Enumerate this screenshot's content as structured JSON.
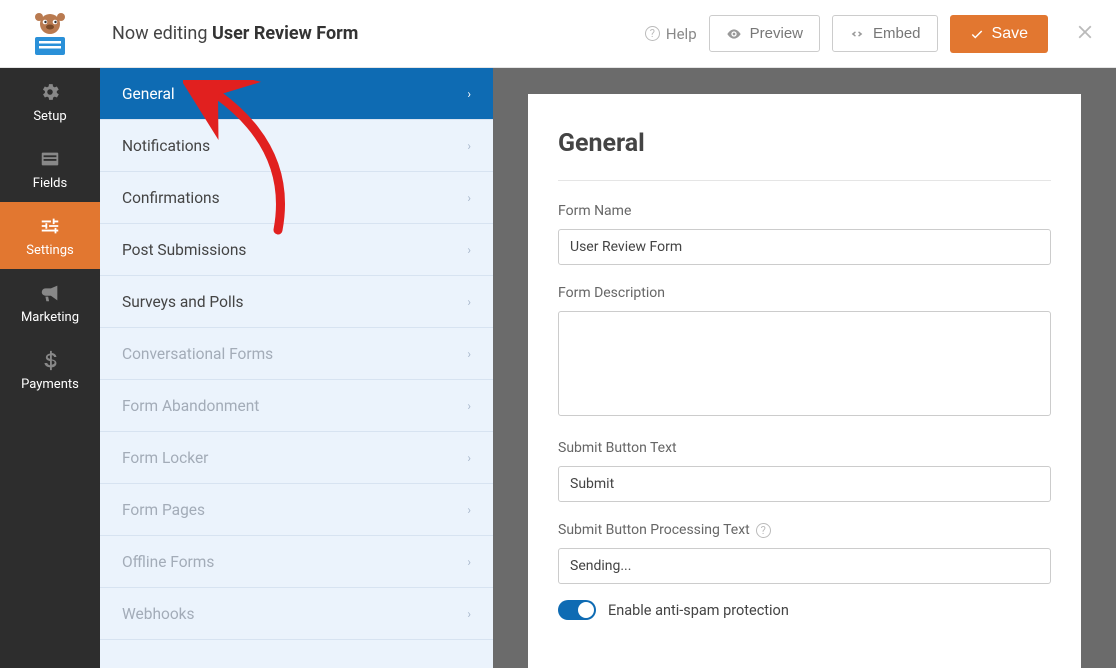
{
  "header": {
    "title_prefix": "Now editing ",
    "title_name": "User Review Form",
    "help": "Help",
    "preview": "Preview",
    "embed": "Embed",
    "save": "Save"
  },
  "rail": {
    "setup": "Setup",
    "fields": "Fields",
    "settings": "Settings",
    "marketing": "Marketing",
    "payments": "Payments"
  },
  "settings_menu": {
    "general": "General",
    "notifications": "Notifications",
    "confirmations": "Confirmations",
    "post_submissions": "Post Submissions",
    "surveys": "Surveys and Polls",
    "conversational": "Conversational Forms",
    "abandonment": "Form Abandonment",
    "locker": "Form Locker",
    "pages": "Form Pages",
    "offline": "Offline Forms",
    "webhooks": "Webhooks"
  },
  "panel": {
    "heading": "General",
    "form_name_label": "Form Name",
    "form_name_value": "User Review Form",
    "form_desc_label": "Form Description",
    "form_desc_value": "",
    "submit_text_label": "Submit Button Text",
    "submit_text_value": "Submit",
    "submit_processing_label": "Submit Button Processing Text",
    "submit_processing_value": "Sending...",
    "antispam_label": "Enable anti-spam protection"
  }
}
